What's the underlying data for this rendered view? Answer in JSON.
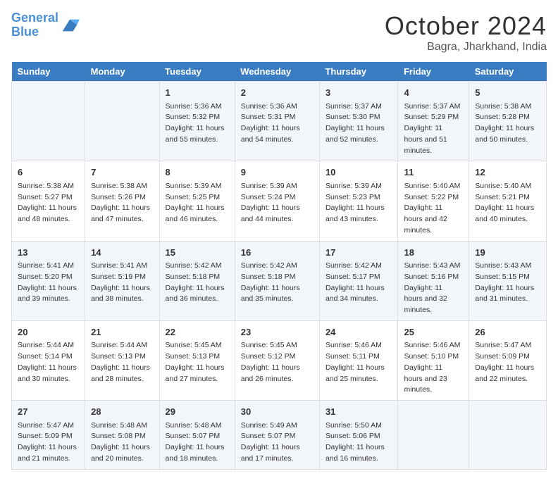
{
  "header": {
    "logo_line1": "General",
    "logo_line2": "Blue",
    "month": "October 2024",
    "location": "Bagra, Jharkhand, India"
  },
  "columns": [
    "Sunday",
    "Monday",
    "Tuesday",
    "Wednesday",
    "Thursday",
    "Friday",
    "Saturday"
  ],
  "weeks": [
    [
      {
        "day": "",
        "sunrise": "",
        "sunset": "",
        "daylight": ""
      },
      {
        "day": "",
        "sunrise": "",
        "sunset": "",
        "daylight": ""
      },
      {
        "day": "1",
        "sunrise": "Sunrise: 5:36 AM",
        "sunset": "Sunset: 5:32 PM",
        "daylight": "Daylight: 11 hours and 55 minutes."
      },
      {
        "day": "2",
        "sunrise": "Sunrise: 5:36 AM",
        "sunset": "Sunset: 5:31 PM",
        "daylight": "Daylight: 11 hours and 54 minutes."
      },
      {
        "day": "3",
        "sunrise": "Sunrise: 5:37 AM",
        "sunset": "Sunset: 5:30 PM",
        "daylight": "Daylight: 11 hours and 52 minutes."
      },
      {
        "day": "4",
        "sunrise": "Sunrise: 5:37 AM",
        "sunset": "Sunset: 5:29 PM",
        "daylight": "Daylight: 11 hours and 51 minutes."
      },
      {
        "day": "5",
        "sunrise": "Sunrise: 5:38 AM",
        "sunset": "Sunset: 5:28 PM",
        "daylight": "Daylight: 11 hours and 50 minutes."
      }
    ],
    [
      {
        "day": "6",
        "sunrise": "Sunrise: 5:38 AM",
        "sunset": "Sunset: 5:27 PM",
        "daylight": "Daylight: 11 hours and 48 minutes."
      },
      {
        "day": "7",
        "sunrise": "Sunrise: 5:38 AM",
        "sunset": "Sunset: 5:26 PM",
        "daylight": "Daylight: 11 hours and 47 minutes."
      },
      {
        "day": "8",
        "sunrise": "Sunrise: 5:39 AM",
        "sunset": "Sunset: 5:25 PM",
        "daylight": "Daylight: 11 hours and 46 minutes."
      },
      {
        "day": "9",
        "sunrise": "Sunrise: 5:39 AM",
        "sunset": "Sunset: 5:24 PM",
        "daylight": "Daylight: 11 hours and 44 minutes."
      },
      {
        "day": "10",
        "sunrise": "Sunrise: 5:39 AM",
        "sunset": "Sunset: 5:23 PM",
        "daylight": "Daylight: 11 hours and 43 minutes."
      },
      {
        "day": "11",
        "sunrise": "Sunrise: 5:40 AM",
        "sunset": "Sunset: 5:22 PM",
        "daylight": "Daylight: 11 hours and 42 minutes."
      },
      {
        "day": "12",
        "sunrise": "Sunrise: 5:40 AM",
        "sunset": "Sunset: 5:21 PM",
        "daylight": "Daylight: 11 hours and 40 minutes."
      }
    ],
    [
      {
        "day": "13",
        "sunrise": "Sunrise: 5:41 AM",
        "sunset": "Sunset: 5:20 PM",
        "daylight": "Daylight: 11 hours and 39 minutes."
      },
      {
        "day": "14",
        "sunrise": "Sunrise: 5:41 AM",
        "sunset": "Sunset: 5:19 PM",
        "daylight": "Daylight: 11 hours and 38 minutes."
      },
      {
        "day": "15",
        "sunrise": "Sunrise: 5:42 AM",
        "sunset": "Sunset: 5:18 PM",
        "daylight": "Daylight: 11 hours and 36 minutes."
      },
      {
        "day": "16",
        "sunrise": "Sunrise: 5:42 AM",
        "sunset": "Sunset: 5:18 PM",
        "daylight": "Daylight: 11 hours and 35 minutes."
      },
      {
        "day": "17",
        "sunrise": "Sunrise: 5:42 AM",
        "sunset": "Sunset: 5:17 PM",
        "daylight": "Daylight: 11 hours and 34 minutes."
      },
      {
        "day": "18",
        "sunrise": "Sunrise: 5:43 AM",
        "sunset": "Sunset: 5:16 PM",
        "daylight": "Daylight: 11 hours and 32 minutes."
      },
      {
        "day": "19",
        "sunrise": "Sunrise: 5:43 AM",
        "sunset": "Sunset: 5:15 PM",
        "daylight": "Daylight: 11 hours and 31 minutes."
      }
    ],
    [
      {
        "day": "20",
        "sunrise": "Sunrise: 5:44 AM",
        "sunset": "Sunset: 5:14 PM",
        "daylight": "Daylight: 11 hours and 30 minutes."
      },
      {
        "day": "21",
        "sunrise": "Sunrise: 5:44 AM",
        "sunset": "Sunset: 5:13 PM",
        "daylight": "Daylight: 11 hours and 28 minutes."
      },
      {
        "day": "22",
        "sunrise": "Sunrise: 5:45 AM",
        "sunset": "Sunset: 5:13 PM",
        "daylight": "Daylight: 11 hours and 27 minutes."
      },
      {
        "day": "23",
        "sunrise": "Sunrise: 5:45 AM",
        "sunset": "Sunset: 5:12 PM",
        "daylight": "Daylight: 11 hours and 26 minutes."
      },
      {
        "day": "24",
        "sunrise": "Sunrise: 5:46 AM",
        "sunset": "Sunset: 5:11 PM",
        "daylight": "Daylight: 11 hours and 25 minutes."
      },
      {
        "day": "25",
        "sunrise": "Sunrise: 5:46 AM",
        "sunset": "Sunset: 5:10 PM",
        "daylight": "Daylight: 11 hours and 23 minutes."
      },
      {
        "day": "26",
        "sunrise": "Sunrise: 5:47 AM",
        "sunset": "Sunset: 5:09 PM",
        "daylight": "Daylight: 11 hours and 22 minutes."
      }
    ],
    [
      {
        "day": "27",
        "sunrise": "Sunrise: 5:47 AM",
        "sunset": "Sunset: 5:09 PM",
        "daylight": "Daylight: 11 hours and 21 minutes."
      },
      {
        "day": "28",
        "sunrise": "Sunrise: 5:48 AM",
        "sunset": "Sunset: 5:08 PM",
        "daylight": "Daylight: 11 hours and 20 minutes."
      },
      {
        "day": "29",
        "sunrise": "Sunrise: 5:48 AM",
        "sunset": "Sunset: 5:07 PM",
        "daylight": "Daylight: 11 hours and 18 minutes."
      },
      {
        "day": "30",
        "sunrise": "Sunrise: 5:49 AM",
        "sunset": "Sunset: 5:07 PM",
        "daylight": "Daylight: 11 hours and 17 minutes."
      },
      {
        "day": "31",
        "sunrise": "Sunrise: 5:50 AM",
        "sunset": "Sunset: 5:06 PM",
        "daylight": "Daylight: 11 hours and 16 minutes."
      },
      {
        "day": "",
        "sunrise": "",
        "sunset": "",
        "daylight": ""
      },
      {
        "day": "",
        "sunrise": "",
        "sunset": "",
        "daylight": ""
      }
    ]
  ]
}
